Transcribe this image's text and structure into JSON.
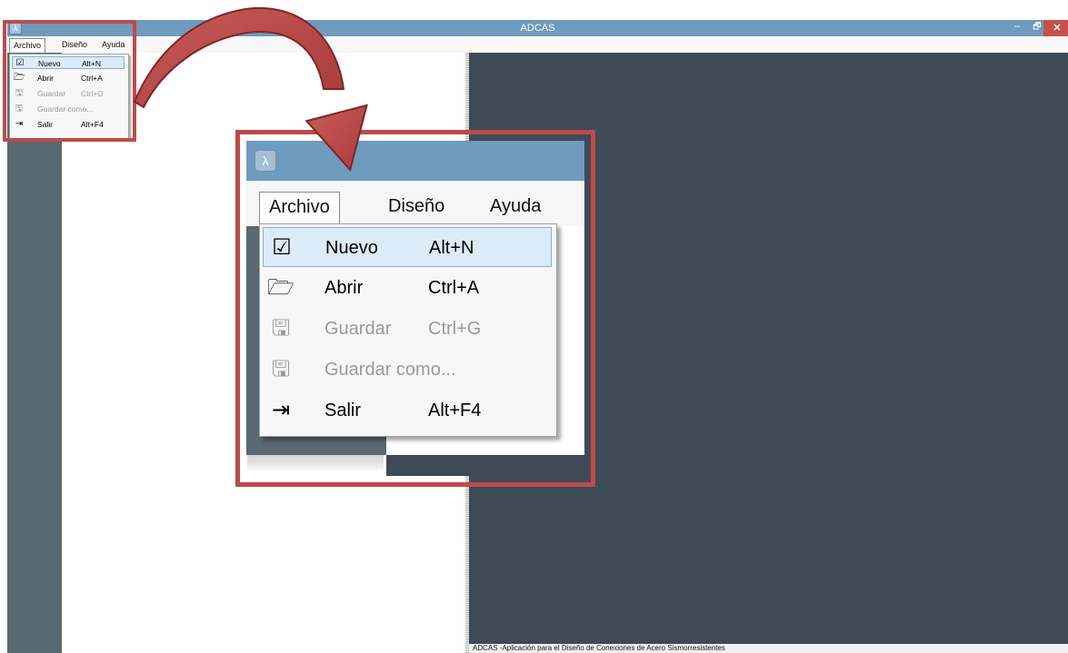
{
  "window": {
    "title": "ADCAS",
    "app_icon": "app-icon",
    "controls": {
      "minimize": "–",
      "maximize": "🗗",
      "close": "✕"
    }
  },
  "menubar": {
    "items": [
      "Archivo",
      "Diseño",
      "Ayuda"
    ]
  },
  "file_menu": {
    "items": [
      {
        "icon": "new-document-icon",
        "glyph": "☑",
        "label": "Nuevo",
        "shortcut": "Alt+N",
        "enabled": true,
        "highlighted": true
      },
      {
        "icon": "open-folder-icon",
        "glyph": "🗁",
        "label": "Abrir",
        "shortcut": "Ctrl+A",
        "enabled": true,
        "highlighted": false
      },
      {
        "icon": "save-icon",
        "glyph": "🖫",
        "label": "Guardar",
        "shortcut": "Ctrl+G",
        "enabled": false,
        "highlighted": false
      },
      {
        "icon": "save-as-icon",
        "glyph": "🖫",
        "label": "Guardar como...",
        "shortcut": "",
        "enabled": false,
        "highlighted": false
      },
      {
        "icon": "exit-icon",
        "glyph": "⇥",
        "label": "Salir",
        "shortcut": "Alt+F4",
        "enabled": true,
        "highlighted": false
      }
    ]
  },
  "statusbar": {
    "text": "ADCAS -Aplicación para el Diseño de Conexiones de Acero Sismorresistentes"
  },
  "colors": {
    "titlebar": "#6f9bbe",
    "sidebar": "#596971",
    "canvas": "#3f4a57",
    "highlight_frame": "#be4b4b",
    "selection": "#dcebf8"
  }
}
